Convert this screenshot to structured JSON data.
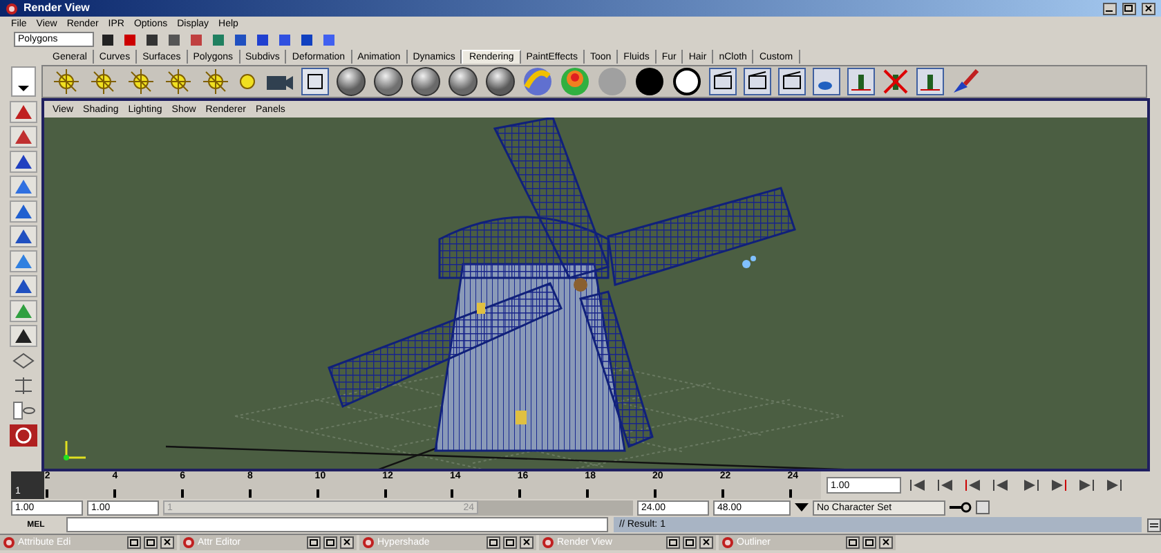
{
  "window": {
    "title": "Render View"
  },
  "menu": [
    "File",
    "View",
    "Render",
    "IPR",
    "Options",
    "Display",
    "Help"
  ],
  "status_line": {
    "menu_set": "Polygons"
  },
  "shelf_tabs": [
    {
      "label": "General",
      "selected": false
    },
    {
      "label": "Curves",
      "selected": false
    },
    {
      "label": "Surfaces",
      "selected": false
    },
    {
      "label": "Polygons",
      "selected": false
    },
    {
      "label": "Subdivs",
      "selected": false
    },
    {
      "label": "Deformation",
      "selected": false
    },
    {
      "label": "Animation",
      "selected": false
    },
    {
      "label": "Dynamics",
      "selected": false
    },
    {
      "label": "Rendering",
      "selected": true
    },
    {
      "label": "PaintEffects",
      "selected": false
    },
    {
      "label": "Toon",
      "selected": false
    },
    {
      "label": "Fluids",
      "selected": false
    },
    {
      "label": "Fur",
      "selected": false
    },
    {
      "label": "Hair",
      "selected": false
    },
    {
      "label": "nCloth",
      "selected": false
    },
    {
      "label": "Custom",
      "selected": false
    }
  ],
  "panel_menu": [
    "View",
    "Shading",
    "Lighting",
    "Show",
    "Renderer",
    "Panels"
  ],
  "time_slider": {
    "current_frame": "1",
    "tick_labels": [
      "2",
      "4",
      "6",
      "8",
      "10",
      "12",
      "14",
      "16",
      "18",
      "20",
      "22",
      "24"
    ],
    "current_time": "1.00"
  },
  "range_slider": {
    "start_time": "1.00",
    "playback_start": "1.00",
    "range_start": "1",
    "range_end": "24",
    "playback_end": "24.00",
    "end_time": "48.00",
    "character_set": "No Character Set"
  },
  "command_line": {
    "label": "MEL",
    "result": "// Result: 1"
  },
  "taskbar": [
    "Attribute Edi",
    "Attr Editor",
    "Hypershade",
    "Render View",
    "Outliner"
  ]
}
